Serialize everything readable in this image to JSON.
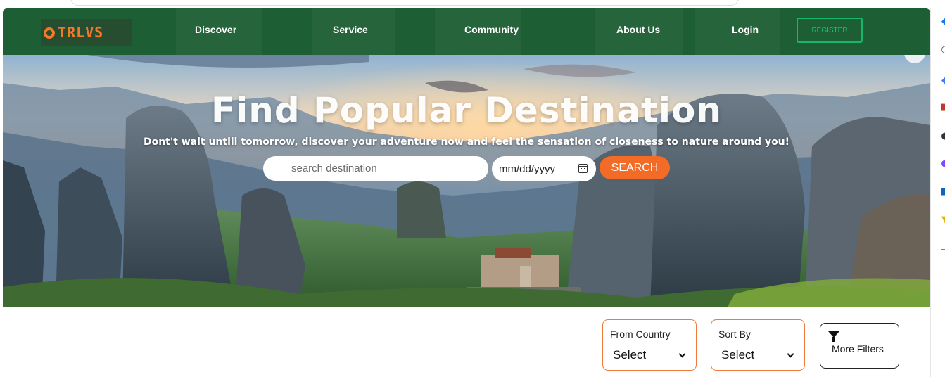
{
  "nav": {
    "logo_text": "TRLVS",
    "links": [
      "Discover",
      "Service",
      "Community",
      "About Us",
      "Login"
    ],
    "register_label": "REGISTER"
  },
  "hero": {
    "title": "Find Popular Destination",
    "subtitle": "Dont't wait untill tomorrow, discover your adventure now and feel the sensation of closeness to nature around you!",
    "search_placeholder": "search destination",
    "date_placeholder": "mm/dd/yyyy",
    "search_button": "SEARCH"
  },
  "filters": {
    "country_label": "From Country",
    "country_value": "Select",
    "sort_label": "Sort By",
    "sort_value": "Select",
    "more_label": "More Filters"
  },
  "colors": {
    "nav_bg": "#1e5e34",
    "accent": "#f26c28",
    "register_border": "#13b86a"
  },
  "icons": [
    "calendar-icon",
    "chevron-down-icon",
    "filter-funnel-icon"
  ]
}
